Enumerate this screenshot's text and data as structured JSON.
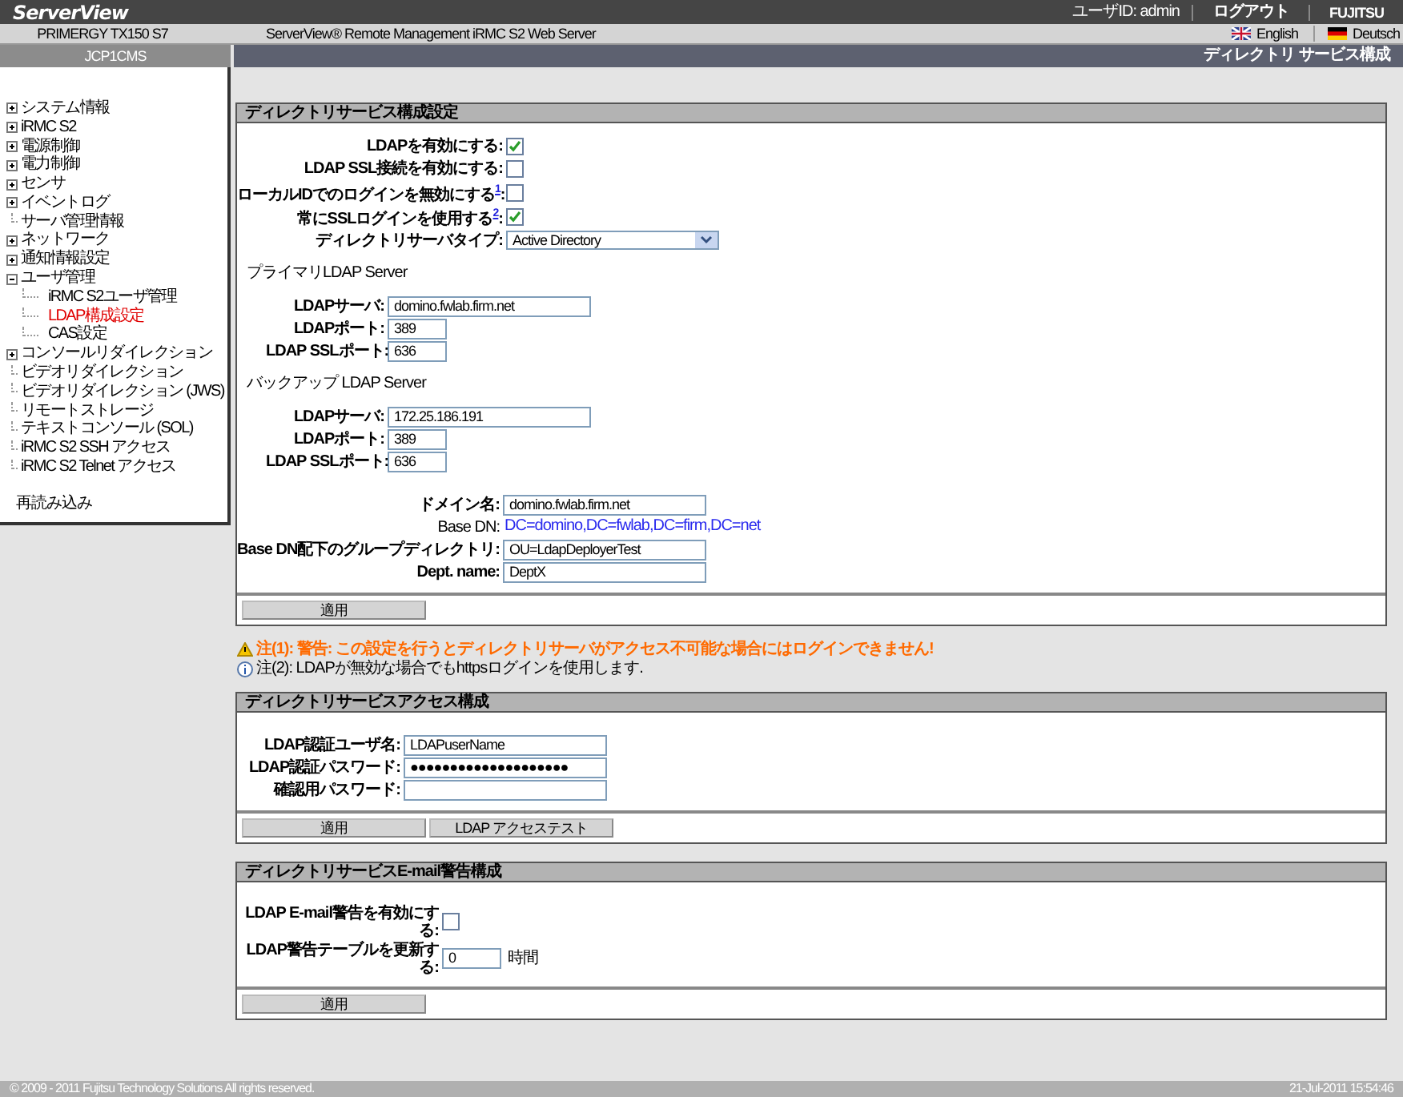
{
  "header": {
    "logo": "ServerView",
    "user_id": "ユーザID: admin",
    "logout": "ログアウト",
    "brand": "FUJITSU"
  },
  "subheader": {
    "server": "PRIMERGY TX150 S7",
    "product": "ServerView® Remote Management iRMC S2 Web Server",
    "languages": [
      {
        "label": "English",
        "kind": "uk"
      },
      {
        "label": "Deutsch",
        "kind": "de"
      }
    ]
  },
  "system_name": "JCP1CMS",
  "page_title": "ディレクトリ サービス構成",
  "sidebar": {
    "items": [
      {
        "label": "システム情報",
        "kind": "folder",
        "expanded": false,
        "selected": false
      },
      {
        "label": "iRMC S2",
        "kind": "folder",
        "expanded": false,
        "selected": false
      },
      {
        "label": "電源制御",
        "kind": "folder",
        "expanded": false,
        "selected": false
      },
      {
        "label": "電力制御",
        "kind": "folder",
        "expanded": false,
        "selected": false
      },
      {
        "label": "センサ",
        "kind": "folder",
        "expanded": false,
        "selected": false
      },
      {
        "label": "イベントログ",
        "kind": "folder",
        "expanded": false,
        "selected": false
      },
      {
        "label": "サーバ管理情報",
        "kind": "leaf",
        "selected": false
      },
      {
        "label": "ネットワーク",
        "kind": "folder",
        "expanded": false,
        "selected": false
      },
      {
        "label": "通知情報設定",
        "kind": "folder",
        "expanded": false,
        "selected": false
      },
      {
        "label": "ユーザ管理",
        "kind": "folder",
        "expanded": true,
        "selected": false,
        "children": [
          {
            "label": "iRMC S2ユーザ管理",
            "kind": "leaf",
            "selected": false
          },
          {
            "label": "LDAP構成設定",
            "kind": "leaf",
            "selected": true
          },
          {
            "label": "CAS設定",
            "kind": "leaf",
            "selected": false
          }
        ]
      },
      {
        "label": "コンソールリダイレクション",
        "kind": "folder",
        "expanded": false,
        "selected": false
      },
      {
        "label": "ビデオリダイレクション",
        "kind": "leaf",
        "selected": false
      },
      {
        "label": "ビデオリダイレクション (JWS)",
        "kind": "leaf",
        "selected": false
      },
      {
        "label": "リモートストレージ",
        "kind": "leaf",
        "selected": false
      },
      {
        "label": "テキストコンソール (SOL)",
        "kind": "leaf",
        "selected": false
      },
      {
        "label": "iRMC S2 SSH アクセス",
        "kind": "leaf",
        "selected": false
      },
      {
        "label": "iRMC S2 Telnet アクセス",
        "kind": "leaf",
        "selected": false
      }
    ],
    "reload": "再読み込み"
  },
  "sections": [
    {
      "title": "ディレクトリサービス構成設定",
      "groups": [
        {
          "kind": "options",
          "rows": [
            {
              "kind": "checkbox",
              "label": "LDAPを有効にする:",
              "checked": true
            },
            {
              "kind": "checkbox",
              "label": "LDAP SSL接続を有効にする:",
              "checked": false
            },
            {
              "kind": "checkbox",
              "label": "ローカルIDでのログインを無効にする",
              "note": "1",
              "suffix": ":",
              "checked": false
            },
            {
              "kind": "checkbox",
              "label": "常にSSLログインを使用する",
              "note": "2",
              "suffix": ":",
              "checked": true
            },
            {
              "kind": "select",
              "label": "ディレクトリサーバタイプ:",
              "value": "Active Directory"
            }
          ]
        },
        {
          "kind": "server",
          "heading": "プライマリLDAP Server",
          "rows": [
            {
              "kind": "text",
              "label": "LDAPサーバ:",
              "value": "domino.fwlab.firm.net"
            },
            {
              "kind": "text",
              "label": "LDAPポート:",
              "value": "389"
            },
            {
              "kind": "text",
              "label": "LDAP SSLポート:",
              "value": "636"
            }
          ]
        },
        {
          "kind": "server",
          "heading": "バックアップ LDAP Server",
          "rows": [
            {
              "kind": "text",
              "label": "LDAPサーバ:",
              "value": "172.25.186.191"
            },
            {
              "kind": "text",
              "label": "LDAPポート:",
              "value": "389"
            },
            {
              "kind": "text",
              "label": "LDAP SSLポート:",
              "value": "636"
            }
          ]
        },
        {
          "kind": "domain",
          "rows": [
            {
              "kind": "text",
              "label": "ドメイン名:",
              "value": "domino.fwlab.firm.net"
            },
            {
              "kind": "static",
              "label": "Base DN:",
              "value": "DC=domino,DC=fwlab,DC=firm,DC=net"
            },
            {
              "kind": "text",
              "label": "Base DN配下のグループディレクトリ:",
              "value": "OU=LdapDeployerTest"
            },
            {
              "kind": "text",
              "label": "Dept. name:",
              "value": "DeptX"
            }
          ]
        }
      ],
      "buttons": [
        "適用"
      ]
    },
    {
      "title": "ディレクトリサービスアクセス構成",
      "groups": [
        {
          "kind": "access",
          "rows": [
            {
              "kind": "text",
              "label": "LDAP認証ユーザ名:",
              "value": "LDAPuserName"
            },
            {
              "kind": "text",
              "label": "LDAP認証パスワード:",
              "value": "●●●●●●●●●●●●●●●●●●●●"
            },
            {
              "kind": "text",
              "label": "確認用パスワード:"
            }
          ]
        }
      ],
      "buttons": [
        "適用",
        "LDAP アクセステスト"
      ]
    },
    {
      "title": "ディレクトリサービスE-mail警告構成",
      "groups": [
        {
          "kind": "email",
          "rows": [
            {
              "kind": "checkbox",
              "label": "LDAP E-mail警告を有効にする:",
              "checked": false
            },
            {
              "kind": "text",
              "label": "LDAP警告テーブルを更新する:",
              "value": "0",
              "unit": "時間"
            }
          ]
        }
      ],
      "buttons": [
        "適用"
      ]
    }
  ],
  "notes": [
    {
      "kind": "warning",
      "text": "注(1): 警告: この設定を行うとディレクトリサーバがアクセス不可能な場合にはログインできません!"
    },
    {
      "kind": "info",
      "text": "注(2): LDAPが無効な場合でもhttpsログインを使用します."
    }
  ],
  "footer": {
    "copyright": "© 2009 - 2011 Fujitsu Technology Solutions All rights reserved.",
    "timestamp": "21-Jul-2011 15:54:46"
  }
}
